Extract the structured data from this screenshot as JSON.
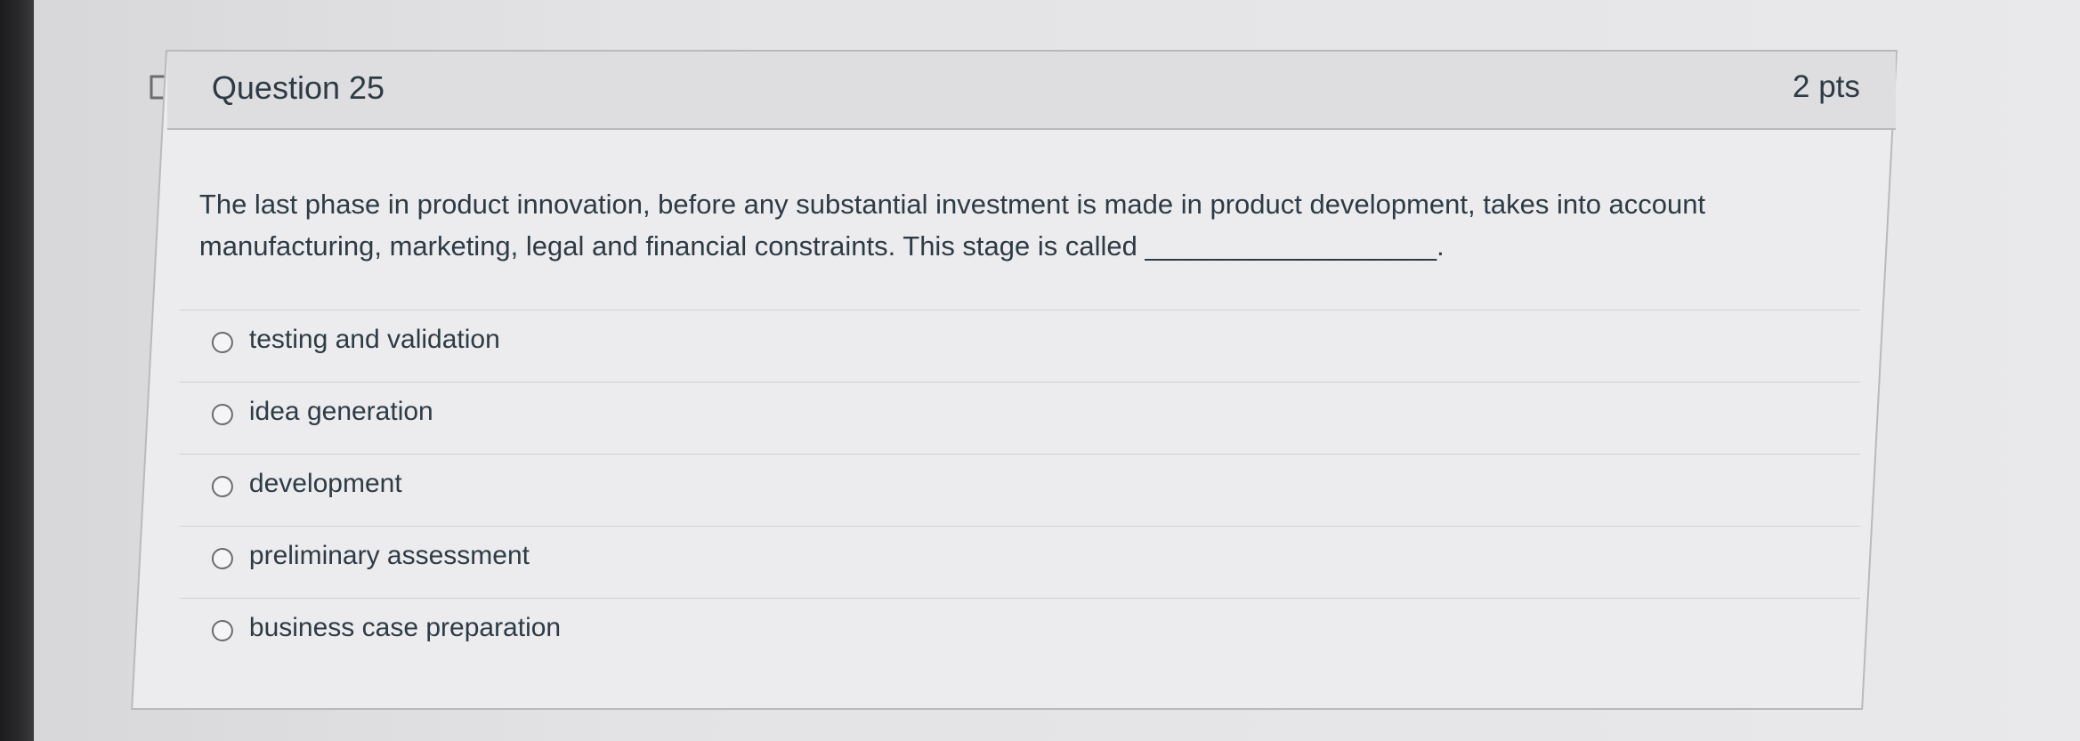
{
  "question": {
    "title": "Question 25",
    "points": "2 pts",
    "text": "The last phase in product innovation, before any substantial investment is made in product development, takes into account manufacturing, marketing, legal and financial constraints. This stage is called ___________________.",
    "flag_icon": "flag-icon"
  },
  "answers": [
    {
      "label": "testing and validation",
      "selected": false
    },
    {
      "label": "idea generation",
      "selected": false
    },
    {
      "label": "development",
      "selected": false
    },
    {
      "label": "preliminary assessment",
      "selected": false
    },
    {
      "label": "business case preparation",
      "selected": false
    }
  ],
  "colors": {
    "text": "#2d3b45",
    "header_bg": "#dedee0",
    "body_bg": "#ececee",
    "border": "#b9b9bd"
  }
}
